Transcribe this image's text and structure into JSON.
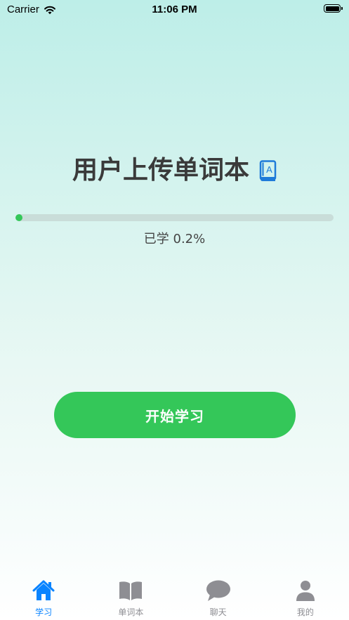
{
  "status_bar": {
    "carrier": "Carrier",
    "time": "11:06 PM"
  },
  "main": {
    "title": "用户上传单词本",
    "title_icon": "book-letter-icon",
    "progress": {
      "fraction": 0.002,
      "label": "已学 0.2%"
    },
    "start_button_label": "开始学习"
  },
  "tab_bar": {
    "items": [
      {
        "label": "学习",
        "icon": "home-icon",
        "active": true
      },
      {
        "label": "单词本",
        "icon": "open-book-icon",
        "active": false
      },
      {
        "label": "聊天",
        "icon": "chat-bubble-icon",
        "active": false
      },
      {
        "label": "我的",
        "icon": "person-icon",
        "active": false
      }
    ]
  },
  "colors": {
    "accent_green": "#34c759",
    "active_tab_blue": "#0a84ff",
    "inactive_gray": "#8e8e93",
    "progress_track": "#c9ddd9"
  }
}
